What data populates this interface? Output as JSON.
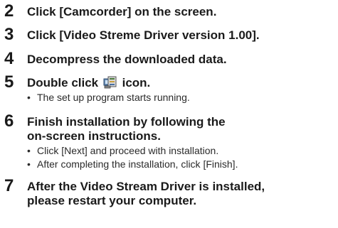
{
  "steps": [
    {
      "number": "2",
      "text": "Click [Camcorder] on the screen."
    },
    {
      "number": "3",
      "text": "Click [Video Streme Driver version 1.00]."
    },
    {
      "number": "4",
      "text": "Decompress the downloaded data."
    },
    {
      "number": "5",
      "text_before": "Double click",
      "text_after": "icon.",
      "icon": "installer-setup-icon",
      "bullets": [
        "The set up program starts running."
      ]
    },
    {
      "number": "6",
      "lines": [
        "Finish installation by following the",
        "on-screen instructions."
      ],
      "bullets": [
        "Click [Next] and proceed with installation.",
        "After completing the installation, click [Finish]."
      ]
    },
    {
      "number": "7",
      "lines": [
        "After the Video Stream Driver is installed,",
        "please restart your computer."
      ]
    }
  ]
}
